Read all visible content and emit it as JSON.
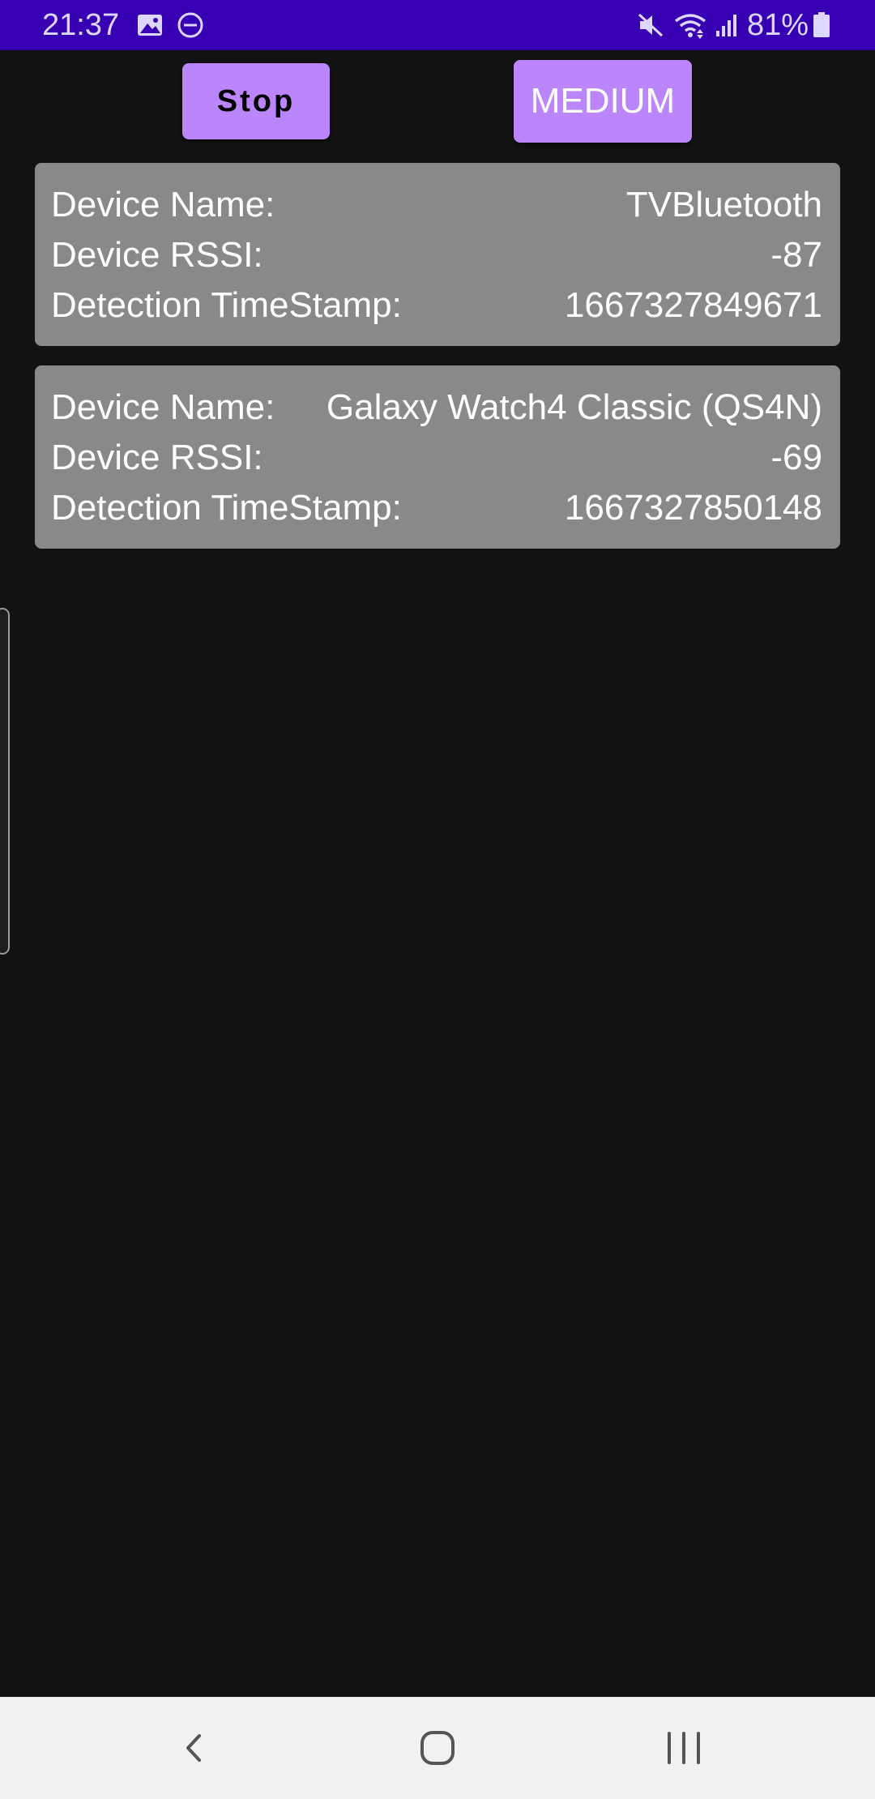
{
  "status_bar": {
    "time": "21:37",
    "battery": "81%",
    "icons": [
      "image-icon",
      "do-not-disturb-icon",
      "mute-icon",
      "wifi-icon",
      "signal-icon",
      "battery-icon"
    ],
    "background": "#3700b3"
  },
  "toolbar": {
    "stop_label": "Stop",
    "mode_label": "MEDIUM",
    "accent": "#bb86fc"
  },
  "devices": [
    {
      "name_label": "Device Name:",
      "name": "TVBluetooth",
      "rssi_label": "Device RSSI:",
      "rssi": "-87",
      "timestamp_label": "Detection TimeStamp:",
      "timestamp": "1667327849671"
    },
    {
      "name_label": "Device Name:",
      "name": "Galaxy Watch4 Classic (QS4N)",
      "rssi_label": "Device RSSI:",
      "rssi": "-69",
      "timestamp_label": "Detection TimeStamp:",
      "timestamp": "1667327850148"
    }
  ],
  "nav_bar": {
    "icons": [
      "back-icon",
      "home-icon",
      "recents-icon"
    ]
  },
  "colors": {
    "background": "#121212",
    "card": "#898989",
    "nav_bar": "#f1f1f1"
  }
}
